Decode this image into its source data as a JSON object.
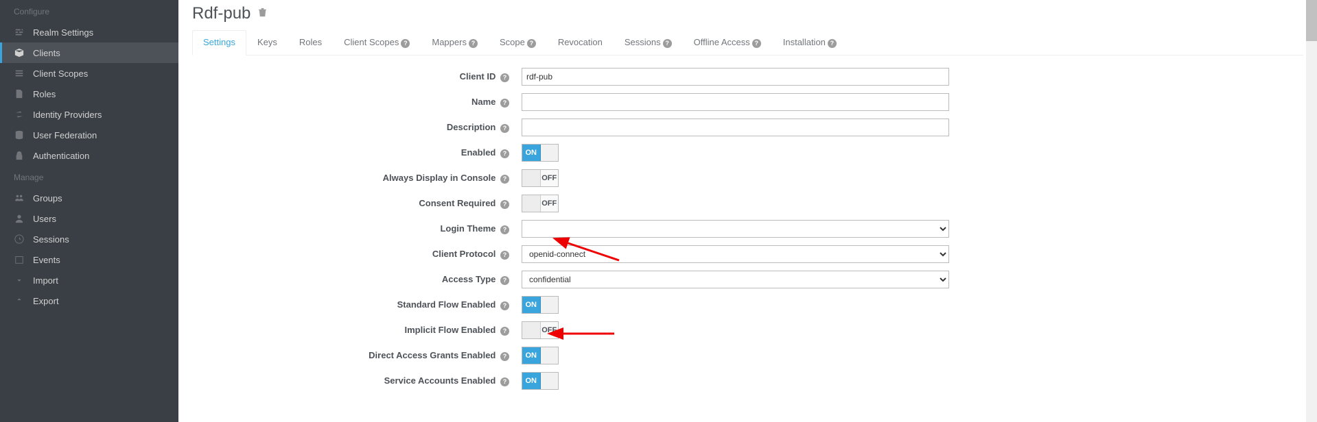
{
  "sidebar": {
    "configure_header": "Configure",
    "manage_header": "Manage",
    "configure_items": [
      {
        "label": "Realm Settings",
        "icon": "sliders-icon"
      },
      {
        "label": "Clients",
        "icon": "cube-icon"
      },
      {
        "label": "Client Scopes",
        "icon": "list-icon"
      },
      {
        "label": "Roles",
        "icon": "file-icon"
      },
      {
        "label": "Identity Providers",
        "icon": "exchange-icon"
      },
      {
        "label": "User Federation",
        "icon": "database-icon"
      },
      {
        "label": "Authentication",
        "icon": "lock-icon"
      }
    ],
    "manage_items": [
      {
        "label": "Groups",
        "icon": "group-icon"
      },
      {
        "label": "Users",
        "icon": "user-icon"
      },
      {
        "label": "Sessions",
        "icon": "clock-icon"
      },
      {
        "label": "Events",
        "icon": "calendar-icon"
      },
      {
        "label": "Import",
        "icon": "import-icon"
      },
      {
        "label": "Export",
        "icon": "export-icon"
      }
    ]
  },
  "page": {
    "title": "Rdf-pub"
  },
  "tabs": [
    {
      "label": "Settings",
      "help": false,
      "active": true
    },
    {
      "label": "Keys",
      "help": false
    },
    {
      "label": "Roles",
      "help": false
    },
    {
      "label": "Client Scopes",
      "help": true
    },
    {
      "label": "Mappers",
      "help": true
    },
    {
      "label": "Scope",
      "help": true
    },
    {
      "label": "Revocation",
      "help": false
    },
    {
      "label": "Sessions",
      "help": true
    },
    {
      "label": "Offline Access",
      "help": true
    },
    {
      "label": "Installation",
      "help": true
    }
  ],
  "form": {
    "client_id_label": "Client ID",
    "client_id_value": "rdf-pub",
    "name_label": "Name",
    "name_value": "",
    "description_label": "Description",
    "description_value": "",
    "enabled_label": "Enabled",
    "enabled_value": "ON",
    "always_display_label": "Always Display in Console",
    "always_display_value": "OFF",
    "consent_required_label": "Consent Required",
    "consent_required_value": "OFF",
    "login_theme_label": "Login Theme",
    "login_theme_value": "",
    "client_protocol_label": "Client Protocol",
    "client_protocol_value": "openid-connect",
    "access_type_label": "Access Type",
    "access_type_value": "confidential",
    "standard_flow_label": "Standard Flow Enabled",
    "standard_flow_value": "ON",
    "implicit_flow_label": "Implicit Flow Enabled",
    "implicit_flow_value": "OFF",
    "direct_access_label": "Direct Access Grants Enabled",
    "direct_access_value": "ON",
    "service_accounts_label": "Service Accounts Enabled",
    "service_accounts_value": "ON",
    "toggle_on_text": "ON",
    "toggle_off_text": "OFF"
  },
  "annotations": {
    "arrow1_target": "access_type",
    "arrow2_target": "service_accounts"
  }
}
